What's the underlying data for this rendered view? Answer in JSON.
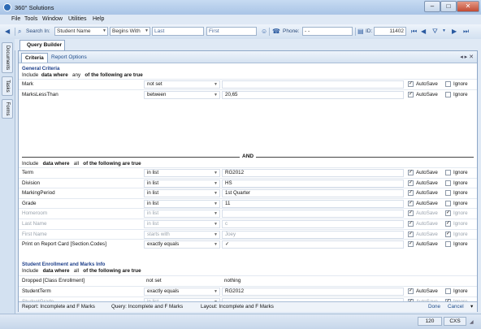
{
  "window": {
    "title": "360° Solutions",
    "minimize": "–",
    "maximize": "□",
    "close": "✕"
  },
  "menu": [
    "File",
    "Tools",
    "Window",
    "Utilities",
    "Help"
  ],
  "toolbar": {
    "search_label": "Search In:",
    "search_in": "Student Name",
    "match_mode": "Begins With",
    "last_label": "Last",
    "first_label": "First",
    "phone_label": "Phone:",
    "phone_value": "-  -",
    "id_label": "ID:",
    "id_value": "11402"
  },
  "side_tabs": [
    "Documents",
    "Tasks",
    "Forms"
  ],
  "document_tab": "Query Builder",
  "sub_tabs": {
    "active": "Criteria",
    "other": "Report Options"
  },
  "general": {
    "header": "General Criteria",
    "include1": {
      "a": "Include",
      "b": "data where",
      "c": "any",
      "d": "of the following are true"
    },
    "rows1": [
      {
        "field": "Mark",
        "op": "not set",
        "value": "",
        "autosave": true,
        "ignore": false,
        "disabled": false
      },
      {
        "field": "MarksLessThan",
        "op": "between",
        "value": "20,65",
        "autosave": true,
        "ignore": false,
        "disabled": false
      }
    ],
    "and_label": "AND",
    "include2": {
      "a": "Include",
      "b": "data where",
      "c": "all",
      "d": "of the following are true"
    },
    "rows2": [
      {
        "field": "Term",
        "op": "in list",
        "value": "RG2012",
        "autosave": true,
        "ignore": false,
        "disabled": false
      },
      {
        "field": "Division",
        "op": "in list",
        "value": "HS",
        "autosave": true,
        "ignore": false,
        "disabled": false
      },
      {
        "field": "MarkingPeriod",
        "op": "in list",
        "value": "1st Quarter",
        "autosave": true,
        "ignore": false,
        "disabled": false
      },
      {
        "field": "Grade",
        "op": "in list",
        "value": "11",
        "autosave": true,
        "ignore": false,
        "disabled": false
      },
      {
        "field": "Homeroom",
        "op": "in list",
        "value": "",
        "autosave": true,
        "ignore": true,
        "disabled": true
      },
      {
        "field": "Last Name",
        "op": "in list",
        "value": "c",
        "autosave": true,
        "ignore": true,
        "disabled": true
      },
      {
        "field": "First Name",
        "op": "starts with",
        "value": "Joey",
        "autosave": true,
        "ignore": true,
        "disabled": true
      },
      {
        "field": "Print on Report Card [Section.Codes]",
        "op": "exactly equals",
        "value": "✓",
        "autosave": true,
        "ignore": false,
        "disabled": false
      }
    ]
  },
  "enrollment": {
    "header": "Student Enrollment and Marks Info",
    "include": {
      "a": "Include",
      "b": "data where",
      "c": "all",
      "d": "of the following are true"
    },
    "static_row": {
      "field": "Dropped [Class Enrollment]",
      "op": "not set",
      "value": "nothing"
    },
    "rows": [
      {
        "field": "StudentTerm",
        "op": "exactly equals",
        "value": "RG2012",
        "autosave": true,
        "ignore": false,
        "disabled": false
      },
      {
        "field": "StudentGrade",
        "op": "in list",
        "value": "",
        "autosave": true,
        "ignore": true,
        "disabled": true
      }
    ]
  },
  "labels": {
    "autosave": "AutoSave",
    "ignore": "Ignore"
  },
  "status": {
    "report": "Report: Incomplete and F Marks",
    "query": "Query: Incomplete and F Marks",
    "layout": "Layout: Incomplete and F Marks",
    "done": "Done",
    "cancel": "Cancel"
  },
  "statusbar": {
    "zoom": "120",
    "mode": "CXS"
  }
}
